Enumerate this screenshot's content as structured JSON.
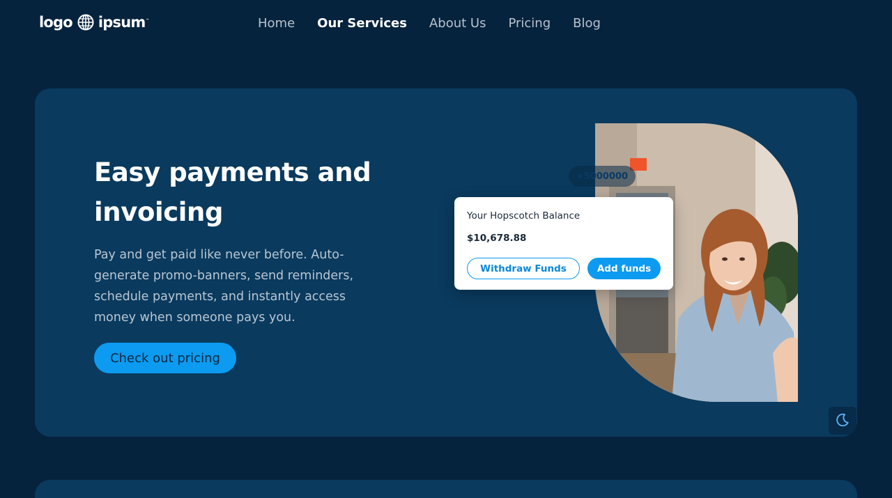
{
  "header": {
    "logo": {
      "text_left": "logo",
      "text_right": "ipsum",
      "icon": "globe-icon"
    },
    "nav": [
      {
        "label": "Home",
        "active": false
      },
      {
        "label": "Our Services",
        "active": true
      },
      {
        "label": "About Us",
        "active": false
      },
      {
        "label": "Pricing",
        "active": false
      },
      {
        "label": "Blog",
        "active": false
      }
    ]
  },
  "hero": {
    "title": "Easy payments and invoicing",
    "description": "Pay and get paid like never before. Auto-generate promo-banners, send reminders, schedule payments, and instantly access money when someone pays you.",
    "cta_label": "Check out pricing",
    "amount_chip": "+5000000",
    "balance_card": {
      "label": "Your Hopscotch Balance",
      "value": "$10,678.88",
      "withdraw_label": "Withdraw Funds",
      "add_label": "Add funds"
    },
    "photo": "woman-smiling-photo"
  },
  "theme_toggle": {
    "icon": "moon-icon"
  },
  "colors": {
    "background": "#06233d",
    "card": "#0a3a5e",
    "accent": "#0c9bf0",
    "text_muted": "#b9c7d3"
  }
}
